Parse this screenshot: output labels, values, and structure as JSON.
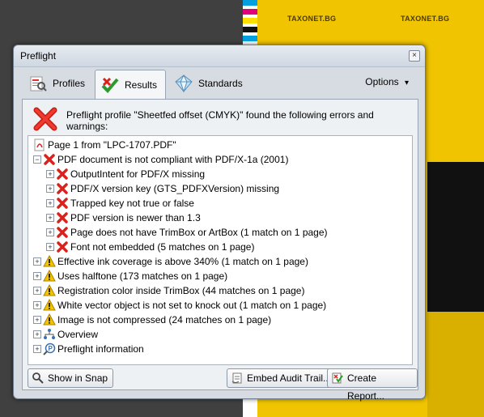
{
  "window": {
    "title": "Preflight",
    "close_label": "×"
  },
  "tabs": [
    {
      "label": "Profiles",
      "icon": "profiles-icon"
    },
    {
      "label": "Results",
      "icon": "results-icon"
    },
    {
      "label": "Standards",
      "icon": "standards-icon"
    }
  ],
  "options_label": "Options",
  "options_arrow": "▾",
  "summary": "Preflight profile \"Sheetfed offset (CMYK)\" found the following errors and warnings:",
  "tree": [
    {
      "text": "Page 1 from \"LPC-1707.PDF\"",
      "icon": "pdf-icon"
    },
    {
      "text": "PDF document is not compliant with PDF/X-1a (2001)",
      "icon": "error-icon"
    },
    {
      "text": "OutputIntent for PDF/X missing",
      "icon": "error-icon"
    },
    {
      "text": "PDF/X version key (GTS_PDFXVersion) missing",
      "icon": "error-icon"
    },
    {
      "text": "Trapped key not true or false",
      "icon": "error-icon"
    },
    {
      "text": "PDF version is newer than 1.3",
      "icon": "error-icon"
    },
    {
      "text": "Page does not have TrimBox or ArtBox (1 match on 1 page)",
      "icon": "error-icon"
    },
    {
      "text": "Font not embedded (5 matches on 1 page)",
      "icon": "error-icon"
    },
    {
      "text": "Effective ink coverage is above 340% (1 match on 1 page)",
      "icon": "warning-icon"
    },
    {
      "text": "Uses halftone (173 matches on 1 page)",
      "icon": "warning-icon"
    },
    {
      "text": "Registration color inside TrimBox (44 matches on 1 page)",
      "icon": "warning-icon"
    },
    {
      "text": "White vector object is not set to knock out (1 match on 1 page)",
      "icon": "warning-icon"
    },
    {
      "text": "Image is not compressed (24 matches on 1 page)",
      "icon": "warning-icon"
    },
    {
      "text": "Overview",
      "icon": "overview-icon"
    },
    {
      "text": "Preflight information",
      "icon": "preflight-info-icon"
    }
  ],
  "buttons": {
    "show_in_snap": "Show in Snap",
    "embed_audit": "Embed Audit Trail...",
    "create_report": "Create Report..."
  },
  "background": {
    "brand": "TAXONET.BG"
  },
  "colors": {
    "error": "#d9221c",
    "warning": "#f5c400",
    "accent": "#3a6fb0"
  }
}
